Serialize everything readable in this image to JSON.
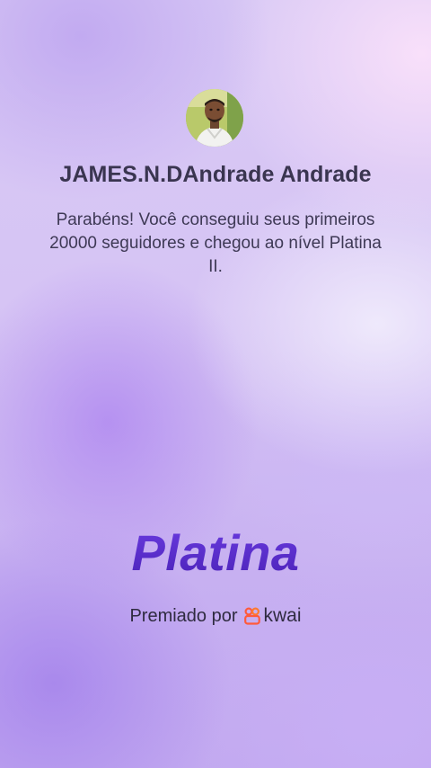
{
  "profile": {
    "name": "JAMES.N.DAndrade Andrade",
    "avatar_icon": "user-photo"
  },
  "congrats": {
    "message": "Parabéns! Você conseguiu seus primeiros 20000 seguidores e chegou ao nível Platina II."
  },
  "tier": {
    "name": "Platina"
  },
  "footer": {
    "awarded_by": "Premiado por",
    "brand": "kwai",
    "brand_color": "#ff5a3c",
    "tier_color": "#5b2bd1"
  }
}
